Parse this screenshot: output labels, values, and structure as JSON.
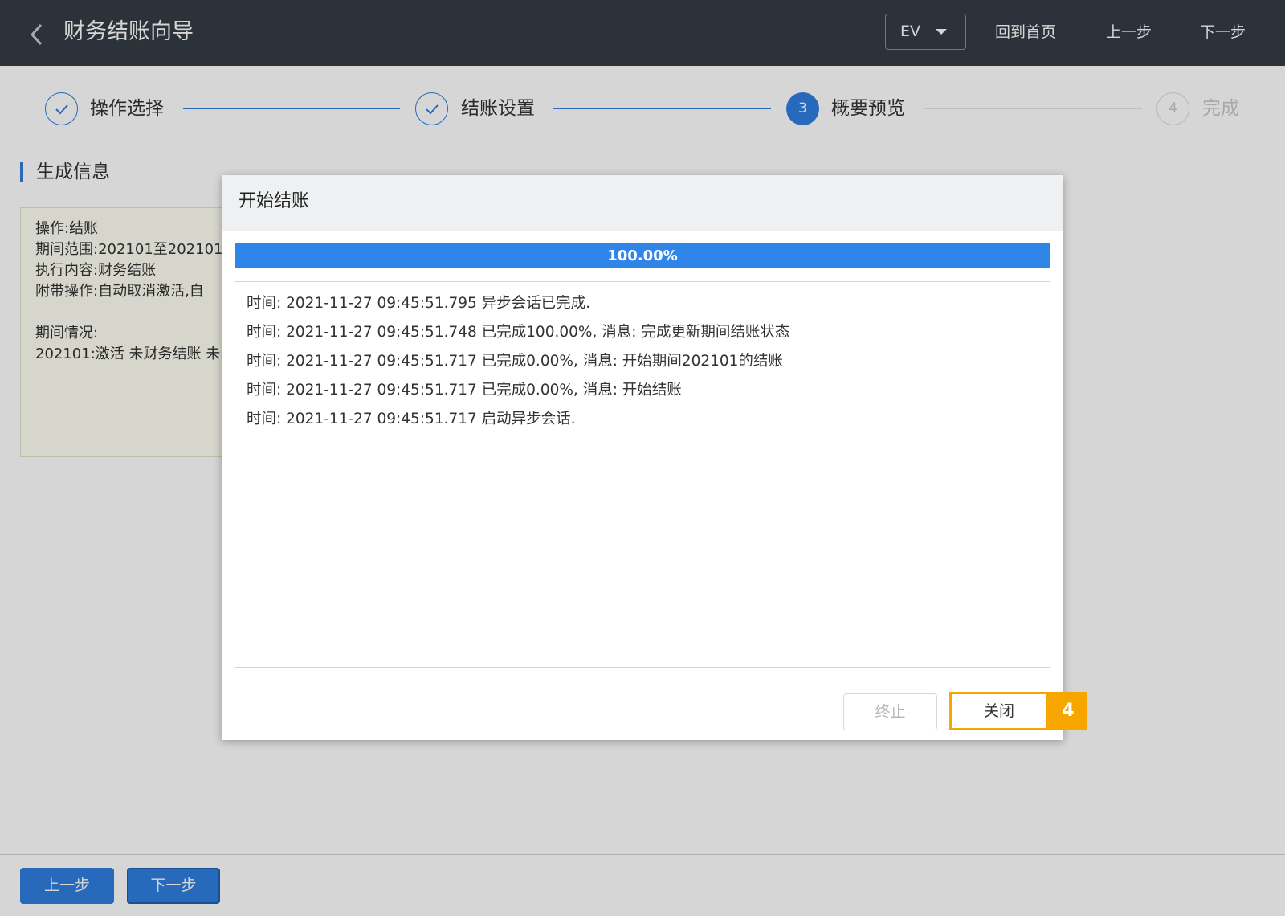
{
  "header": {
    "title": "财务结账向导",
    "ev_label": "EV",
    "links": [
      "回到首页",
      "上一步",
      "下一步"
    ]
  },
  "steps": [
    {
      "label": "操作选择",
      "state": "done"
    },
    {
      "label": "结账设置",
      "state": "done"
    },
    {
      "number": "3",
      "label": "概要预览",
      "state": "active"
    },
    {
      "number": "4",
      "label": "完成",
      "state": "todo"
    }
  ],
  "section": {
    "title": "生成信息",
    "lines": [
      "操作:结账",
      "期间范围:202101至202101",
      "执行内容:财务结账",
      "附带操作:自动取消激活,自",
      "期间情况:",
      "202101:激活 未财务结账 未"
    ]
  },
  "footer": {
    "prev_label": "上一步",
    "next_label": "下一步"
  },
  "dialog": {
    "title": "开始结账",
    "progress_percent": 100,
    "progress_text": "100.00%",
    "log": [
      "时间: 2021-11-27 09:45:51.795 异步会话已完成.",
      "时间: 2021-11-27 09:45:51.748 已完成100.00%, 消息: 完成更新期间结账状态",
      "时间: 2021-11-27 09:45:51.717 已完成0.00%, 消息: 开始期间202101的结账",
      "时间: 2021-11-27 09:45:51.717 已完成0.00%, 消息: 开始结账",
      "时间: 2021-11-27 09:45:51.717 启动异步会话."
    ],
    "stop_label": "终止",
    "close_label": "关闭",
    "annotation_badge": "4"
  },
  "colors": {
    "primary": "#2f7fe0",
    "topbar": "#343c44",
    "highlight": "#f7a600"
  }
}
